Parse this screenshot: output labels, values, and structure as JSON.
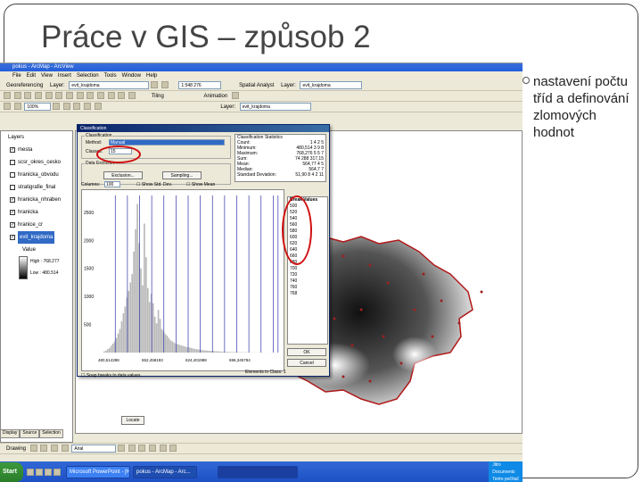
{
  "slide": {
    "title": "Práce v GIS – způsob 2",
    "bullet": "nastavení počtu tříd a definování zlomových hodnot"
  },
  "app": {
    "title": "pokus - ArcMap - ArcView",
    "menu": [
      "File",
      "Edit",
      "View",
      "Insert",
      "Selection",
      "Tools",
      "Window",
      "Help"
    ],
    "georef_label": "Georeferencing",
    "layer_label": "Layer:",
    "layer_value": "evit_krajdoma",
    "scale_value": "1:548 276",
    "spatial_analyst": "Spatial Analyst",
    "layer2_value": "evit_krajdoma",
    "tiling_label": "Tiling",
    "animation_label": "Animation",
    "layer3_value": "evit_krajdoma",
    "zoom_value": "100%",
    "font_value": "Arial",
    "drawing_label": "Drawing"
  },
  "toc": {
    "header": "Layers",
    "layers": [
      {
        "label": "mesta",
        "checked": true
      },
      {
        "label": "scsr_okres_cesko",
        "checked": false
      },
      {
        "label": "hranicka_obvodu",
        "checked": false
      },
      {
        "label": "stratigrafie_final",
        "checked": false
      },
      {
        "label": "hranicka_nhraben",
        "checked": true
      },
      {
        "label": "hranicka",
        "checked": true
      },
      {
        "label": "hranice_cr",
        "checked": true
      },
      {
        "label": "evit_krajdoma",
        "checked": true,
        "selected": true
      }
    ],
    "value_label": "Value",
    "high": "High : 768.277",
    "low": "Low : 480.514",
    "tabs": [
      "Display",
      "Source",
      "Selection"
    ]
  },
  "dialog": {
    "title": "Classification",
    "classification_group": "Classification",
    "method_label": "Method:",
    "method_value": "Manual",
    "classes_label": "Classes:",
    "classes_value": "15",
    "data_exclusion": "Data Exclusion",
    "exclusion_btn": "Exclusion...",
    "sampling_btn": "Sampling...",
    "columns_label": "Columns:",
    "columns_value": "100",
    "show_std_dev": "Show Std. Dev.",
    "show_mean": "Show Mean",
    "stats_group": "Classification Statistics",
    "stats": [
      {
        "label": "Count:",
        "value": "1 4 2 5"
      },
      {
        "label": "Minimum:",
        "value": "480,514 3 9 8"
      },
      {
        "label": "Maximum:",
        "value": "768,276 5 5 7"
      },
      {
        "label": "Sum:",
        "value": "74 288 317,15"
      },
      {
        "label": "Mean:",
        "value": "564,77 4 5"
      },
      {
        "label": "Median:",
        "value": "564,7 7"
      },
      {
        "label": "Standard Deviation:",
        "value": "51,90 8 4 2 11"
      }
    ],
    "break_group": "Break Values",
    "breaks": [
      "500",
      "520",
      "540",
      "560",
      "580",
      "600",
      "620",
      "640",
      "660",
      "680",
      "700",
      "720",
      "740",
      "760",
      "768"
    ],
    "ok_btn": "OK",
    "cancel_btn": "Cancel",
    "snap_label": "Snap breaks to data values",
    "elements_label": "Elements in Class:",
    "elements_value": "1",
    "locate_btn": "Locate",
    "y_ticks": [
      "2500",
      "2000",
      "1500",
      "1000",
      "500"
    ],
    "x_ticks": [
      "480,514398",
      "552,458193",
      "624,401988",
      "696,345784"
    ]
  },
  "taskbar": {
    "start": "Start",
    "items": [
      "Microsoft PowerPoint - [Ho...",
      "pokus - ArcMap - Arc..."
    ],
    "tray": [
      "Jitro",
      "Documents",
      "Tento počítač"
    ]
  },
  "chart_data": {
    "type": "bar",
    "title": "",
    "xlabel": "",
    "ylabel": "",
    "ylim": [
      0,
      2800
    ],
    "xlim": [
      480.514398,
      768.276557
    ],
    "values": [
      20,
      35,
      60,
      80,
      120,
      160,
      200,
      260,
      340,
      420,
      560,
      700,
      820,
      980,
      1100,
      1250,
      1400,
      1800,
      2200,
      2650,
      1950,
      1500,
      1200,
      2300,
      1700,
      1150,
      900,
      1050,
      880,
      640,
      520,
      760,
      600,
      420,
      380,
      330,
      300,
      260,
      220,
      200,
      180,
      160,
      150,
      140,
      130,
      120,
      110,
      100,
      95,
      90,
      80,
      70,
      65,
      60,
      55,
      50,
      45,
      40,
      38,
      35,
      32,
      30,
      28,
      26,
      24,
      22,
      20,
      18,
      16,
      15,
      14,
      13,
      12,
      11,
      10,
      9,
      8,
      7,
      6,
      6,
      5,
      5,
      4,
      4,
      3,
      3,
      3,
      2,
      2,
      2,
      2,
      1,
      1,
      1,
      1,
      1,
      1,
      1,
      1,
      1
    ],
    "break_lines": [
      500,
      520,
      540,
      560,
      580,
      600,
      620,
      640,
      660,
      680,
      700,
      720,
      740,
      760,
      768
    ],
    "colors": {
      "bars": "#b8b8b8",
      "breaks": "#3333aa"
    }
  },
  "colors": {
    "annotation": "#d01010",
    "map_border": "#b01818",
    "taskbar": "#245edb"
  }
}
